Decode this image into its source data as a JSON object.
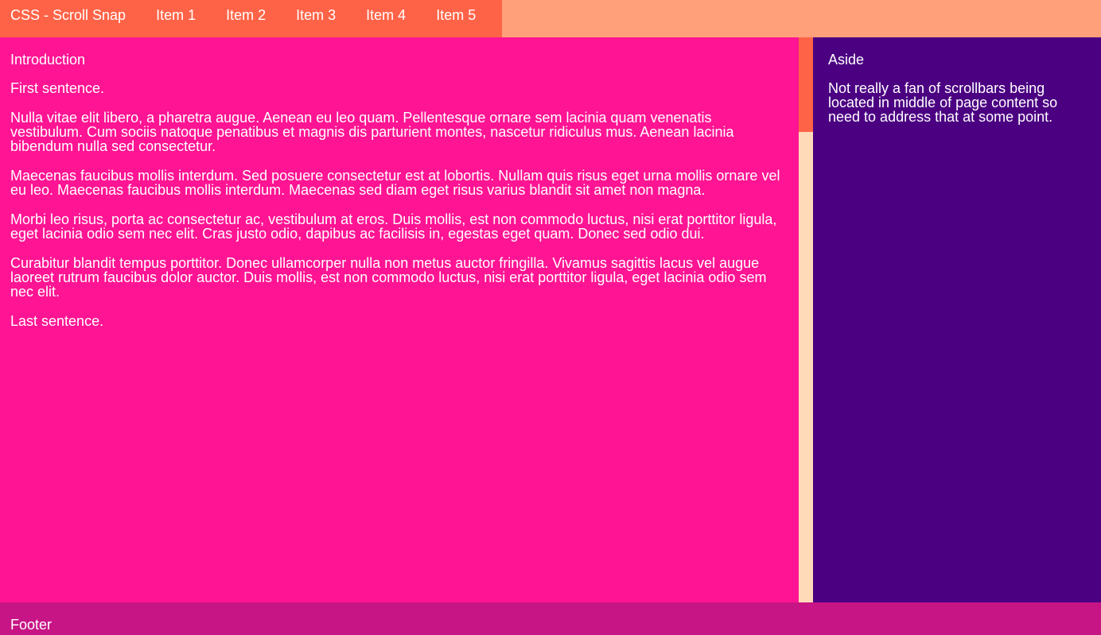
{
  "colors": {
    "header_bg": "#ffa07a",
    "nav_bg": "#ff6347",
    "main_bg": "#ff1493",
    "scroll_track": "#ffdab9",
    "scroll_thumb": "#ff6347",
    "aside_bg": "#4b0082",
    "footer_bg": "#c71585",
    "text": "#ffffff"
  },
  "nav": {
    "title": "CSS - Scroll Snap",
    "items": [
      "Item 1",
      "Item 2",
      "Item 3",
      "Item 4",
      "Item 5"
    ]
  },
  "main": {
    "heading": "Introduction",
    "paragraphs": [
      "First sentence.",
      "Nulla vitae elit libero, a pharetra augue. Aenean eu leo quam. Pellentesque ornare sem lacinia quam venenatis vestibulum. Cum sociis natoque penatibus et magnis dis parturient montes, nascetur ridiculus mus. Aenean lacinia bibendum nulla sed consectetur.",
      "Maecenas faucibus mollis interdum. Sed posuere consectetur est at lobortis. Nullam quis risus eget urna mollis ornare vel eu leo. Maecenas faucibus mollis interdum. Maecenas sed diam eget risus varius blandit sit amet non magna.",
      "Morbi leo risus, porta ac consectetur ac, vestibulum at eros. Duis mollis, est non commodo luctus, nisi erat porttitor ligula, eget lacinia odio sem nec elit. Cras justo odio, dapibus ac facilisis in, egestas eget quam. Donec sed odio dui.",
      "Curabitur blandit tempus porttitor. Donec ullamcorper nulla non metus auctor fringilla. Vivamus sagittis lacus vel augue laoreet rutrum faucibus dolor auctor. Duis mollis, est non commodo luctus, nisi erat porttitor ligula, eget lacinia odio sem nec elit.",
      "Last sentence."
    ]
  },
  "aside": {
    "heading": "Aside",
    "text": "Not really a fan of scrollbars being located in middle of page content so need to address that at some point."
  },
  "footer": {
    "text": "Footer"
  }
}
